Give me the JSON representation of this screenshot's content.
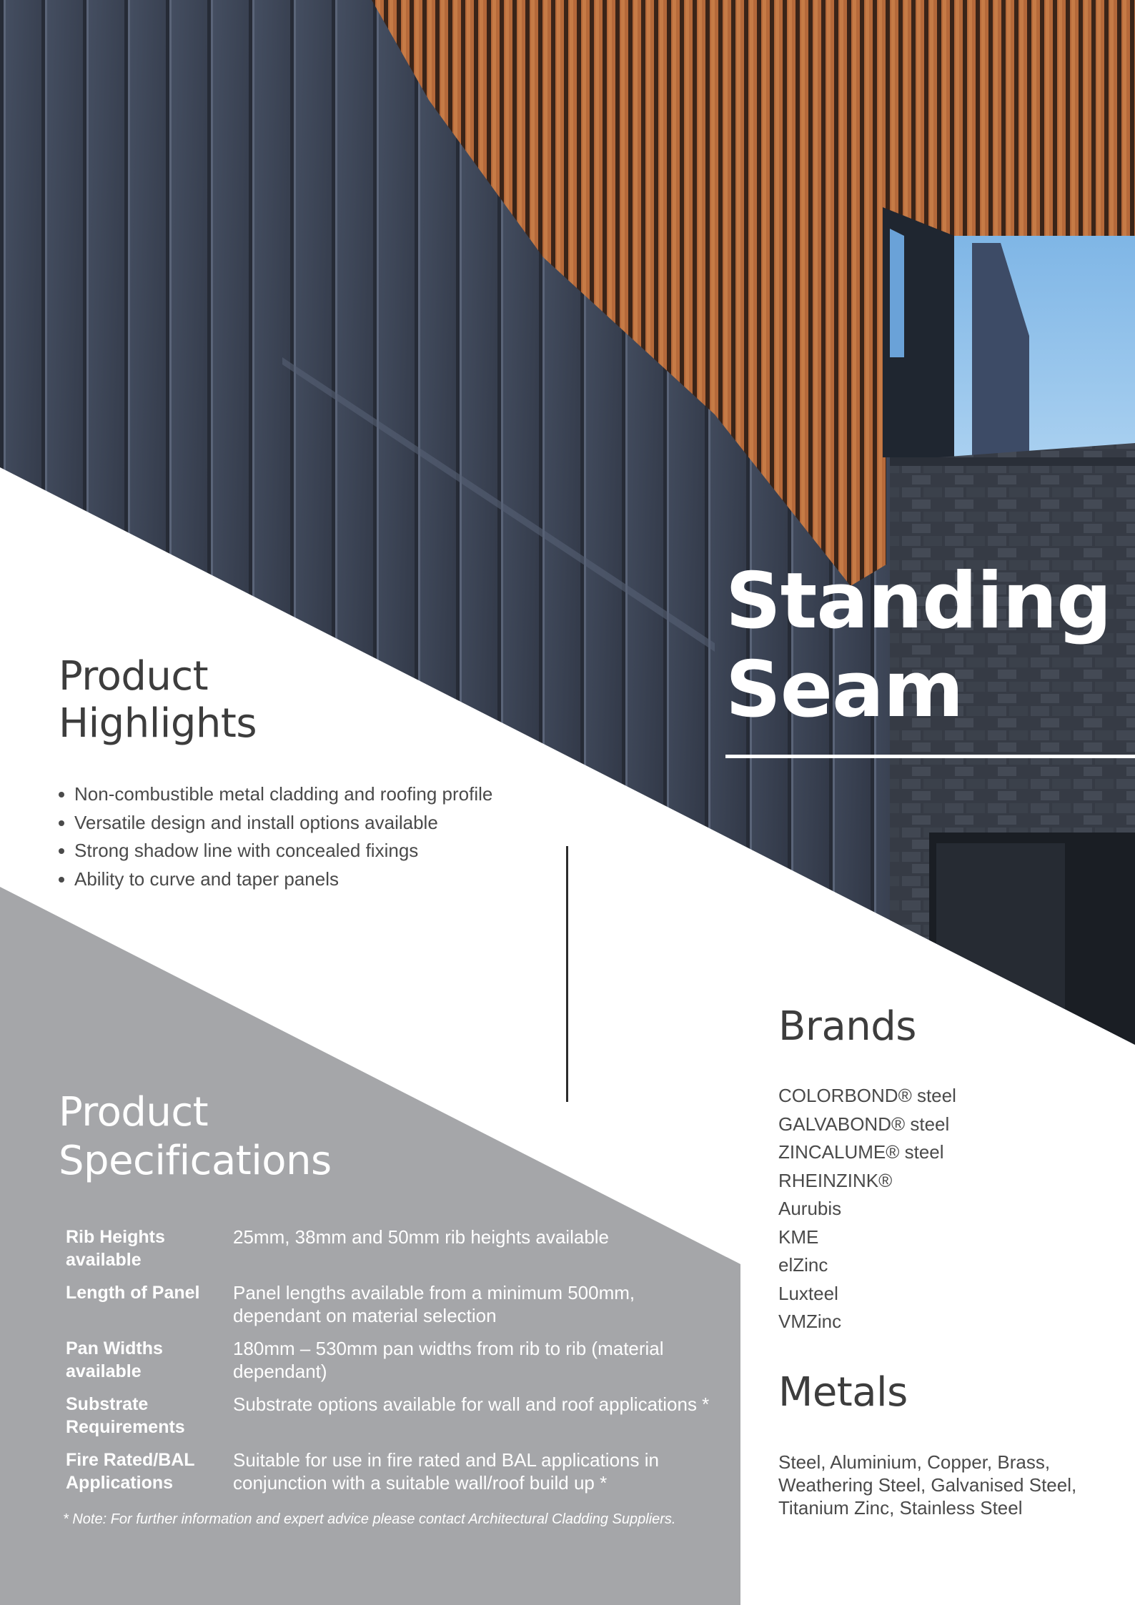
{
  "hero": {
    "title_line1": "Standing",
    "title_line2": "Seam"
  },
  "highlights": {
    "heading_line1": "Product",
    "heading_line2": "Highlights",
    "items": [
      "Non-combustible metal cladding and roofing profile",
      "Versatile design and install options available",
      "Strong shadow line with concealed fixings",
      "Ability to curve and taper panels"
    ]
  },
  "specs": {
    "heading_line1": "Product",
    "heading_line2": "Specifications",
    "rows": [
      {
        "label": "Rib Heights available",
        "value": "25mm, 38mm and 50mm rib heights available"
      },
      {
        "label": "Length of Panel",
        "value": "Panel lengths available from a minimum 500mm, dependant on material selection"
      },
      {
        "label": "Pan Widths available",
        "value": "180mm – 530mm pan widths from rib to rib (material dependant)"
      },
      {
        "label": "Substrate Requirements",
        "value": "Substrate options available for wall and roof applications *"
      },
      {
        "label": "Fire Rated/BAL Applications",
        "value": "Suitable for use in fire rated and BAL applications in conjunction with a suitable wall/roof build up *"
      }
    ],
    "note": "* Note: For further information and expert advice please contact Architectural Cladding Suppliers."
  },
  "brands": {
    "heading": "Brands",
    "items": [
      "COLORBOND® steel",
      "GALVABOND® steel",
      "ZINCALUME® steel",
      "RHEINZINK®",
      "Aurubis",
      "KME",
      "elZinc",
      "Luxteel",
      "VMZinc"
    ]
  },
  "metals": {
    "heading": "Metals",
    "text": "Steel, Aluminium, Copper, Brass, Weathering Steel, Galvanised Steel, Titanium Zinc, Stainless Steel"
  },
  "colors": {
    "text_dark": "#3d3d3d",
    "specs_panel": "#a5a6a9",
    "cladding": "#3b4352",
    "timber": "#b0663a",
    "sky": "#8ec0ea"
  }
}
